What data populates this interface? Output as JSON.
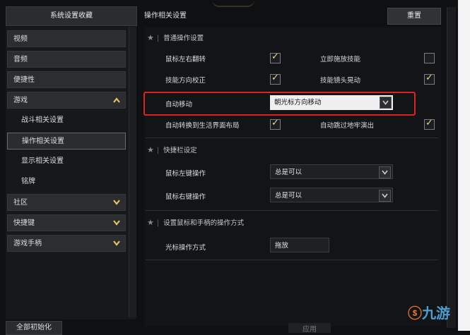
{
  "sidebar": {
    "header": "系统设置收藏",
    "items": [
      {
        "label": "视频",
        "type": "category"
      },
      {
        "label": "音频",
        "type": "category"
      },
      {
        "label": "便捷性",
        "type": "category"
      },
      {
        "label": "游戏",
        "type": "category",
        "expanded": true
      },
      {
        "label": "战斗相关设置",
        "type": "sub"
      },
      {
        "label": "操作相关设置",
        "type": "sub",
        "active": true
      },
      {
        "label": "显示相关设置",
        "type": "sub"
      },
      {
        "label": "铭牌",
        "type": "sub"
      },
      {
        "label": "社区",
        "type": "category"
      },
      {
        "label": "快捷键",
        "type": "category"
      },
      {
        "label": "游戏手柄",
        "type": "category"
      }
    ],
    "bottom_button": "全部初始化"
  },
  "main": {
    "title": "操作相关设置",
    "reset_label": "重置",
    "apply_label": "应用",
    "sections": {
      "general": {
        "title": "普通操作设置",
        "rows": [
          {
            "left": "鼠标左右翻转",
            "left_checked": true,
            "right": "立即施放技能",
            "right_checked": false
          },
          {
            "left": "技能方向校正",
            "left_checked": true,
            "right": "技能镜头晃动",
            "right_checked": true
          }
        ],
        "auto_move_label": "自动移动",
        "auto_move_value": "朝光标方向移动",
        "last_row": {
          "left": "自动转换到生活界面布局",
          "left_checked": true,
          "right": "自动跳过地牢演出",
          "right_checked": true
        }
      },
      "quickbar": {
        "title": "快捷栏设定",
        "left_click_label": "鼠标左键操作",
        "left_click_value": "总是可以",
        "right_click_label": "鼠标右键操作",
        "right_click_value": "总是可以"
      },
      "mouse_pad": {
        "title": "设置鼠标和手柄的操作方式",
        "cursor_label": "光标操作方式",
        "cursor_value": "拖放"
      }
    }
  },
  "watermark": {
    "text": "九游"
  },
  "colors": {
    "highlight": "#e02222",
    "check": "#f0d88a",
    "chevron": "#e8c25a"
  }
}
